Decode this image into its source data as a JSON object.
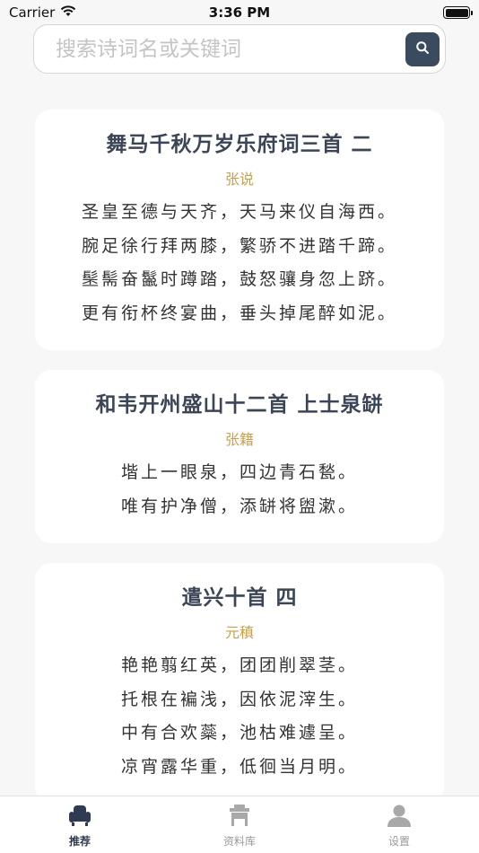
{
  "status": {
    "carrier": "Carrier",
    "time": "3:36 PM"
  },
  "search": {
    "placeholder": "搜索诗词名或关键词",
    "value": ""
  },
  "poems": [
    {
      "title": "舞马千秋万岁乐府词三首 二",
      "author": "张说",
      "lines": [
        "圣皇至德与天齐，天马来仪自海西。",
        "腕足徐行拜两膝，繁骄不进踏千蹄。",
        "髬髵奋鬣时蹲踏，鼓怒骧身忽上跻。",
        "更有衔杯终宴曲，垂头掉尾醉如泥。"
      ]
    },
    {
      "title": "和韦开州盛山十二首 上士泉缾",
      "author": "张籍",
      "lines": [
        "堦上一眼泉，四边青石甃。",
        "唯有护净僧，添缾将盥漱。"
      ]
    },
    {
      "title": "遣兴十首 四",
      "author": "元稹",
      "lines": [
        "艳艳翦红英，团团削翠茎。",
        "托根在褊浅，因依泥滓生。",
        "中有合欢蘂，池枯难遽呈。",
        "凉宵露华重，低徊当月明。"
      ]
    }
  ],
  "tabs": [
    {
      "label": "推荐",
      "icon": "armchair-icon",
      "active": true
    },
    {
      "label": "资料库",
      "icon": "library-icon",
      "active": false
    },
    {
      "label": "设置",
      "icon": "person-icon",
      "active": false
    }
  ],
  "colors": {
    "accent": "#3a4a5f",
    "author": "#c8a04f",
    "title": "#3b4556"
  }
}
